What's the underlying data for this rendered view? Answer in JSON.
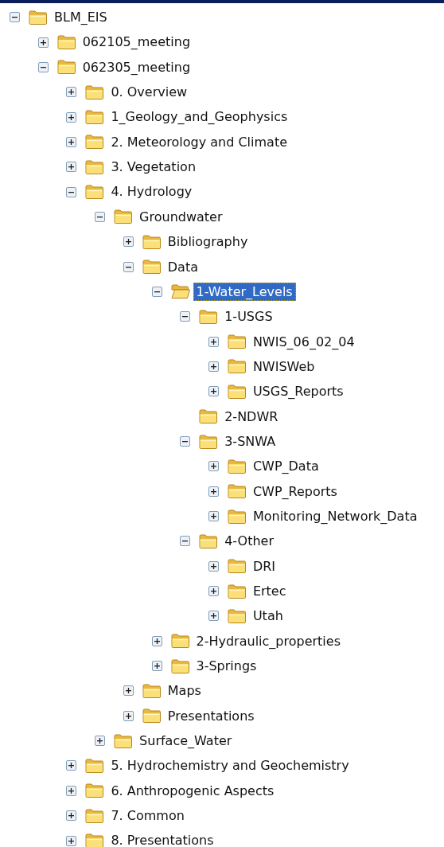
{
  "tree": [
    {
      "label": "BLM_EIS",
      "kind": "expandable",
      "expanded": true,
      "selected": false,
      "children": [
        {
          "label": "062105_meeting",
          "kind": "expandable",
          "expanded": false,
          "selected": false
        },
        {
          "label": "062305_meeting",
          "kind": "expandable",
          "expanded": true,
          "selected": false,
          "children": [
            {
              "label": "0. Overview",
              "kind": "expandable",
              "expanded": false,
              "selected": false
            },
            {
              "label": "1_Geology_and_Geophysics",
              "kind": "expandable",
              "expanded": false,
              "selected": false
            },
            {
              "label": "2. Meteorology and Climate",
              "kind": "expandable",
              "expanded": false,
              "selected": false
            },
            {
              "label": "3. Vegetation",
              "kind": "expandable",
              "expanded": false,
              "selected": false
            },
            {
              "label": "4. Hydrology",
              "kind": "expandable",
              "expanded": true,
              "selected": false,
              "children": [
                {
                  "label": "Groundwater",
                  "kind": "expandable",
                  "expanded": true,
                  "selected": false,
                  "children": [
                    {
                      "label": "Bibliography",
                      "kind": "expandable",
                      "expanded": false,
                      "selected": false
                    },
                    {
                      "label": "Data",
                      "kind": "expandable",
                      "expanded": true,
                      "selected": false,
                      "children": [
                        {
                          "label": "1-Water_Levels",
                          "kind": "expandable",
                          "expanded": true,
                          "selected": true,
                          "children": [
                            {
                              "label": "1-USGS",
                              "kind": "expandable",
                              "expanded": true,
                              "selected": false,
                              "children": [
                                {
                                  "label": "NWIS_06_02_04",
                                  "kind": "expandable",
                                  "expanded": false,
                                  "selected": false
                                },
                                {
                                  "label": "NWISWeb",
                                  "kind": "expandable",
                                  "expanded": false,
                                  "selected": false
                                },
                                {
                                  "label": "USGS_Reports",
                                  "kind": "expandable",
                                  "expanded": false,
                                  "selected": false
                                }
                              ]
                            },
                            {
                              "label": "2-NDWR",
                              "kind": "leaf",
                              "selected": false
                            },
                            {
                              "label": "3-SNWA",
                              "kind": "expandable",
                              "expanded": true,
                              "selected": false,
                              "children": [
                                {
                                  "label": "CWP_Data",
                                  "kind": "expandable",
                                  "expanded": false,
                                  "selected": false
                                },
                                {
                                  "label": "CWP_Reports",
                                  "kind": "expandable",
                                  "expanded": false,
                                  "selected": false
                                },
                                {
                                  "label": "Monitoring_Network_Data",
                                  "kind": "expandable",
                                  "expanded": false,
                                  "selected": false
                                }
                              ]
                            },
                            {
                              "label": "4-Other",
                              "kind": "expandable",
                              "expanded": true,
                              "selected": false,
                              "children": [
                                {
                                  "label": "DRI",
                                  "kind": "expandable",
                                  "expanded": false,
                                  "selected": false
                                },
                                {
                                  "label": "Ertec",
                                  "kind": "expandable",
                                  "expanded": false,
                                  "selected": false
                                },
                                {
                                  "label": "Utah",
                                  "kind": "expandable",
                                  "expanded": false,
                                  "selected": false
                                }
                              ]
                            }
                          ]
                        },
                        {
                          "label": "2-Hydraulic_properties",
                          "kind": "expandable",
                          "expanded": false,
                          "selected": false
                        },
                        {
                          "label": "3-Springs",
                          "kind": "expandable",
                          "expanded": false,
                          "selected": false
                        }
                      ]
                    },
                    {
                      "label": "Maps",
                      "kind": "expandable",
                      "expanded": false,
                      "selected": false
                    },
                    {
                      "label": "Presentations",
                      "kind": "expandable",
                      "expanded": false,
                      "selected": false
                    }
                  ]
                },
                {
                  "label": "Surface_Water",
                  "kind": "expandable",
                  "expanded": false,
                  "selected": false
                }
              ]
            },
            {
              "label": "5. Hydrochemistry and Geochemistry",
              "kind": "expandable",
              "expanded": false,
              "selected": false
            },
            {
              "label": "6. Anthropogenic Aspects",
              "kind": "expandable",
              "expanded": false,
              "selected": false
            },
            {
              "label": "7. Common",
              "kind": "expandable",
              "expanded": false,
              "selected": false
            },
            {
              "label": "8. Presentations",
              "kind": "expandable",
              "expanded": false,
              "selected": false
            }
          ]
        }
      ]
    }
  ]
}
